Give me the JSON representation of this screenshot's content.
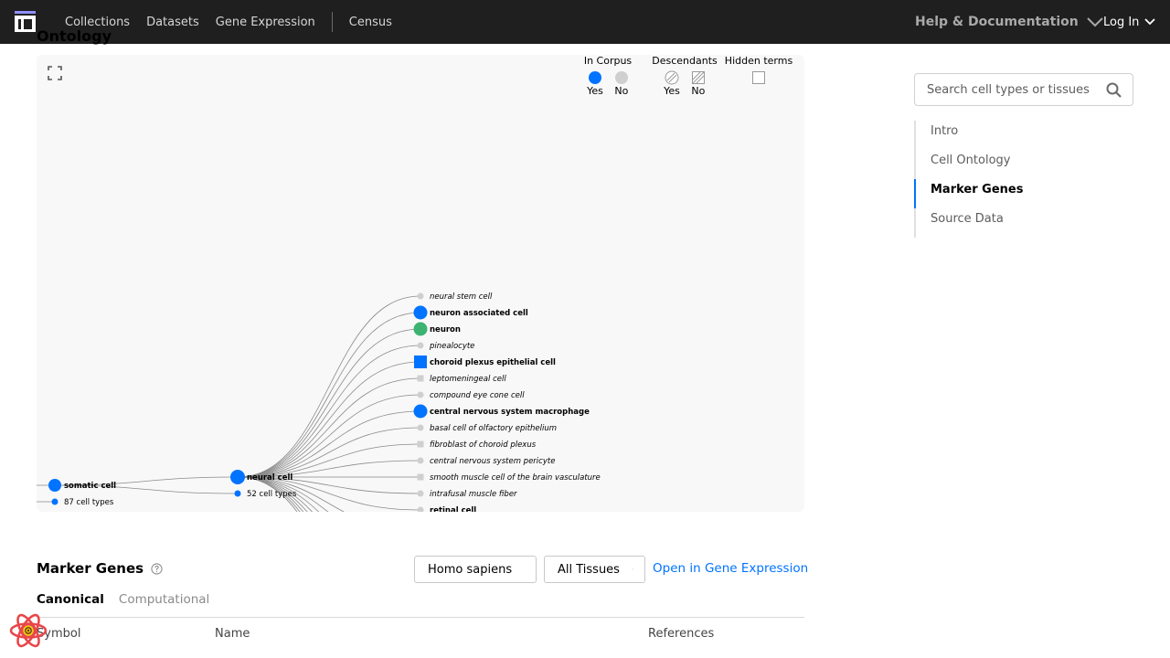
{
  "nav": {
    "links": [
      "Collections",
      "Datasets",
      "Gene Expression"
    ],
    "census": "Census",
    "help": "Help & Documentation",
    "login": "Log In"
  },
  "section_head_clip": "Ontology",
  "legend": {
    "in_corpus": {
      "title": "In Corpus",
      "yes": "Yes",
      "no": "No"
    },
    "descendants": {
      "title": "Descendants",
      "yes": "Yes",
      "no": "No"
    },
    "hidden": {
      "title": "Hidden terms"
    }
  },
  "colors": {
    "accent": "#0073ff",
    "in_corpus": "#0073ff",
    "not_in_corpus": "#cfcfcf",
    "highlight": "#3cb371",
    "nav_bg": "#1f1f1f"
  },
  "tree": {
    "root": {
      "label": "somatic cell",
      "count": "87 cell types"
    },
    "mid": {
      "label": "neural cell",
      "count": "52 cell types"
    },
    "children": [
      {
        "label": "neural stem cell",
        "in_corpus": false,
        "shape": "circle"
      },
      {
        "label": "neuron associated cell",
        "in_corpus": true,
        "shape": "circle"
      },
      {
        "label": "neuron",
        "in_corpus": true,
        "shape": "circle",
        "highlight": true
      },
      {
        "label": "pinealocyte",
        "in_corpus": false,
        "shape": "circle"
      },
      {
        "label": "choroid plexus epithelial cell",
        "in_corpus": true,
        "shape": "square"
      },
      {
        "label": "leptomeningeal cell",
        "in_corpus": false,
        "shape": "square"
      },
      {
        "label": "compound eye cone cell",
        "in_corpus": false,
        "shape": "circle"
      },
      {
        "label": "central nervous system macrophage",
        "in_corpus": true,
        "shape": "circle"
      },
      {
        "label": "basal cell of olfactory epithelium",
        "in_corpus": false,
        "shape": "circle"
      },
      {
        "label": "fibroblast of choroid plexus",
        "in_corpus": false,
        "shape": "square"
      },
      {
        "label": "central nervous system pericyte",
        "in_corpus": false,
        "shape": "circle"
      },
      {
        "label": "smooth muscle cell of the brain vasculature",
        "in_corpus": false,
        "shape": "square"
      },
      {
        "label": "intrafusal muscle fiber",
        "in_corpus": false,
        "shape": "circle"
      },
      {
        "label": "retinal cell",
        "in_corpus": false,
        "shape": "circle",
        "bold": true
      }
    ]
  },
  "search": {
    "placeholder": "Search cell types or tissues"
  },
  "toc": [
    "Intro",
    "Cell Ontology",
    "Marker Genes",
    "Source Data"
  ],
  "toc_active": "Marker Genes",
  "marker_genes": {
    "title": "Marker Genes",
    "species": "Homo sapiens",
    "tissues": "All Tissues",
    "open_link": "Open in Gene Expression",
    "tabs": [
      "Canonical",
      "Computational"
    ],
    "active_tab": "Canonical",
    "columns": [
      "Symbol",
      "Name",
      "References"
    ]
  }
}
